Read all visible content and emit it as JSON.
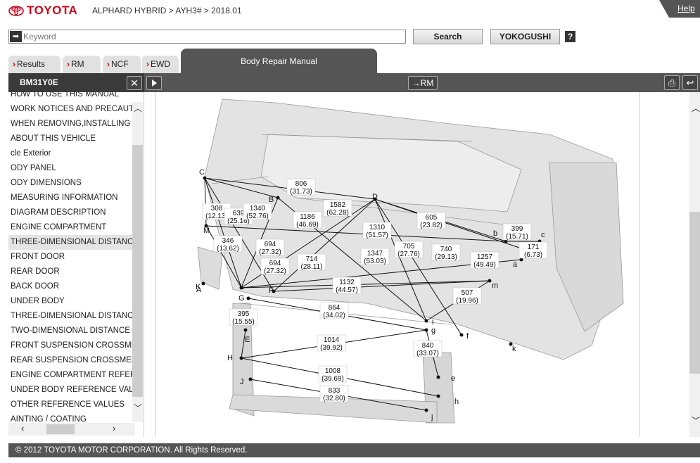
{
  "header": {
    "brand": "TOYOTA",
    "breadcrumb": "ALPHARD HYBRID > AYH3# > 2018.01",
    "help": "Help"
  },
  "search": {
    "placeholder": "Keyword",
    "search_label": "Search",
    "yokogushi_label": "YOKOGUSHI",
    "help_icon": "?"
  },
  "tabs": {
    "results": "Results",
    "rm": "RM",
    "ncf": "NCF",
    "ewd": "EWD",
    "active": "Body Repair Manual"
  },
  "toolbar": {
    "doc_id": "BM31Y0E",
    "rm_link": "RM"
  },
  "sidebar": {
    "items": [
      "HOW TO USE THIS MANUAL",
      "WORK NOTICES AND PRECAUTIONS",
      "WHEN REMOVING,INSTALLING",
      "ABOUT THIS VEHICLE",
      "cle Exterior",
      "ODY PANEL",
      "ODY DIMENSIONS",
      "MEASURING INFORMATION",
      "DIAGRAM DESCRIPTION",
      "ENGINE COMPARTMENT",
      "THREE-DIMENSIONAL DISTANCE",
      "FRONT DOOR",
      "REAR DOOR",
      "BACK DOOR",
      "UNDER BODY",
      "THREE-DIMENSIONAL DISTANCE",
      "TWO-DIMENSIONAL DISTANCE",
      "FRONT SUSPENSION CROSSMEMBER",
      "REAR SUSPENSION CROSSMEMBER",
      "ENGINE COMPARTMENT REFERENCE",
      "UNDER BODY REFERENCE VALUES",
      "OTHER REFERENCE VALUES",
      "AINTING / COATING"
    ],
    "selected_index": 10
  },
  "diagram": {
    "points": [
      "A",
      "B",
      "C",
      "D",
      "E",
      "F",
      "G",
      "H",
      "J",
      "K",
      "L",
      "M",
      "a",
      "b",
      "c",
      "e",
      "f",
      "g",
      "h",
      "i",
      "j",
      "k",
      "m"
    ],
    "dimensions": [
      {
        "mm": "806",
        "in": "(31.73)"
      },
      {
        "mm": "308",
        "in": "(12.13)"
      },
      {
        "mm": "639",
        "in": "(25.16)"
      },
      {
        "mm": "1340",
        "in": "(52.76)"
      },
      {
        "mm": "1186",
        "in": "(46.69)"
      },
      {
        "mm": "1582",
        "in": "(62.28)"
      },
      {
        "mm": "605",
        "in": "(23.82)"
      },
      {
        "mm": "399",
        "in": "(15.71)"
      },
      {
        "mm": "1310",
        "in": "(51.57)"
      },
      {
        "mm": "346",
        "in": "(13.62)"
      },
      {
        "mm": "694",
        "in": "(27.32)"
      },
      {
        "mm": "705",
        "in": "(27.76)"
      },
      {
        "mm": "740",
        "in": "(29.13)"
      },
      {
        "mm": "171",
        "in": "(6.73)"
      },
      {
        "mm": "694",
        "in": "(27.32)"
      },
      {
        "mm": "714",
        "in": "(28.11)"
      },
      {
        "mm": "1347",
        "in": "(53.03)"
      },
      {
        "mm": "1257",
        "in": "(49.49)"
      },
      {
        "mm": "1132",
        "in": "(44.57)"
      },
      {
        "mm": "507",
        "in": "(19.96)"
      },
      {
        "mm": "864",
        "in": "(34.02)"
      },
      {
        "mm": "395",
        "in": "(15.55)"
      },
      {
        "mm": "1014",
        "in": "(39.92)"
      },
      {
        "mm": "840",
        "in": "(33.07)"
      },
      {
        "mm": "1008",
        "in": "(39.69)"
      },
      {
        "mm": "833",
        "in": "(32.80)"
      }
    ]
  },
  "footer": {
    "copyright": "© 2012 TOYOTA MOTOR CORPORATION. All Rights Reserved."
  },
  "colors": {
    "brand_red": "#d0021b",
    "bar_gray": "#555555"
  }
}
